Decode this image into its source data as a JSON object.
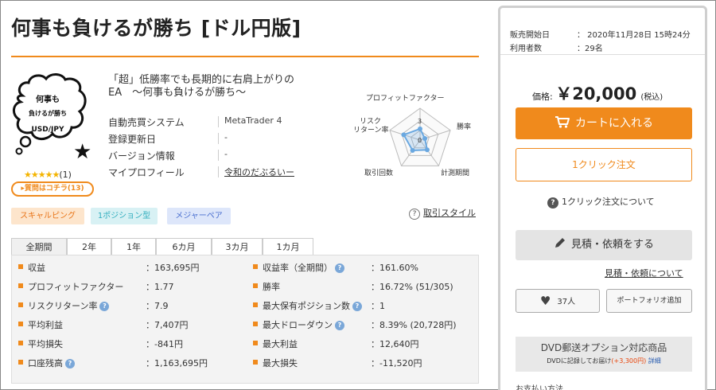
{
  "product": {
    "title": "何事も負けるが勝ち [ドル円版]",
    "catchcopy_line1": "「超」低勝率でも長期的に右肩上がりの",
    "catchcopy_line2": "EA　～何事も負けるが勝ち～",
    "bubble_line1": "何事も",
    "bubble_line2": "負けるが勝ち",
    "bubble_line3": "USD/JPY",
    "stars": "★★★★★",
    "review_count": "(1)",
    "question_button": "▸質問はコチラ(13)",
    "info": [
      {
        "key": "自動売買システム",
        "value": "MetaTrader 4"
      },
      {
        "key": "登録更新日",
        "value": "-"
      },
      {
        "key": "バージョン情報",
        "value": "-"
      },
      {
        "key": "マイプロフィール",
        "value": "令和のだぶるいー"
      }
    ],
    "tags": [
      "スキャルピング",
      "1ポジション型",
      "メジャーペア"
    ],
    "style_link": "取引スタイル"
  },
  "radar": {
    "labels": {
      "top": "プロフィットファクター",
      "right_top": "勝率",
      "right_bottom": "計測期間",
      "left_bottom": "取引回数",
      "left_top_1": "リスク",
      "left_top_2": "リターン率"
    },
    "axis_tick_3": "3",
    "axis_tick_0": "0",
    "values": [
      1.77,
      0.8,
      1.9,
      2.0,
      2.7
    ]
  },
  "tabs": [
    "全期間",
    "2年",
    "1年",
    "6カ月",
    "3カ月",
    "1カ月"
  ],
  "stats_left": [
    {
      "key": "収益",
      "value": "：163,695円",
      "help": false
    },
    {
      "key": "プロフィットファクター",
      "value": "：1.77",
      "help": false
    },
    {
      "key": "リスクリターン率",
      "value": "：7.9",
      "help": true
    },
    {
      "key": "平均利益",
      "value": "：7,407円",
      "help": false
    },
    {
      "key": "平均損失",
      "value": "：-841円",
      "help": false
    },
    {
      "key": "口座残高",
      "value": "：1,163,695円",
      "help": true
    }
  ],
  "stats_right": [
    {
      "key": "収益率（全期間）",
      "value": "：161.60%",
      "help": true
    },
    {
      "key": "勝率",
      "value": "：16.72% (51/305)",
      "help": false
    },
    {
      "key": "最大保有ポジション数",
      "value": "：1",
      "help": true
    },
    {
      "key": "最大ドローダウン",
      "value": "：8.39% (20,728円)",
      "help": true
    },
    {
      "key": "最大利益",
      "value": "：12,640円",
      "help": false
    },
    {
      "key": "最大損失",
      "value": "：-11,520円",
      "help": false
    }
  ],
  "sidebar": {
    "release_label": "販売開始日",
    "release_value": "：  2020年11月28日 15時24分",
    "users_label": "利用者数",
    "users_value": "：29名",
    "price_label": "価格: ",
    "price_value": "￥20,000",
    "price_tax": "(税込)",
    "cart_button": "カートに入れる",
    "oneclick_button": "1クリック注文",
    "oneclick_about": "1クリック注文について",
    "estimate_button": "見積・依頼をする",
    "estimate_link": "見積・依頼について",
    "favorite_count": "37人",
    "portfolio_button": "ポートフォリオ追加",
    "dvd_title": "DVD郵送オプション対応商品",
    "dvd_note": "DVDに記録してお届け",
    "dvd_price": "(+3,300円)",
    "dvd_detail": "詳細",
    "cutoff_text": "お支払い方法"
  },
  "colors": {
    "accent": "#f08a1c",
    "star": "#f4b400",
    "help": "#7aa7d8",
    "radar_stroke": "#6aa8e0"
  }
}
